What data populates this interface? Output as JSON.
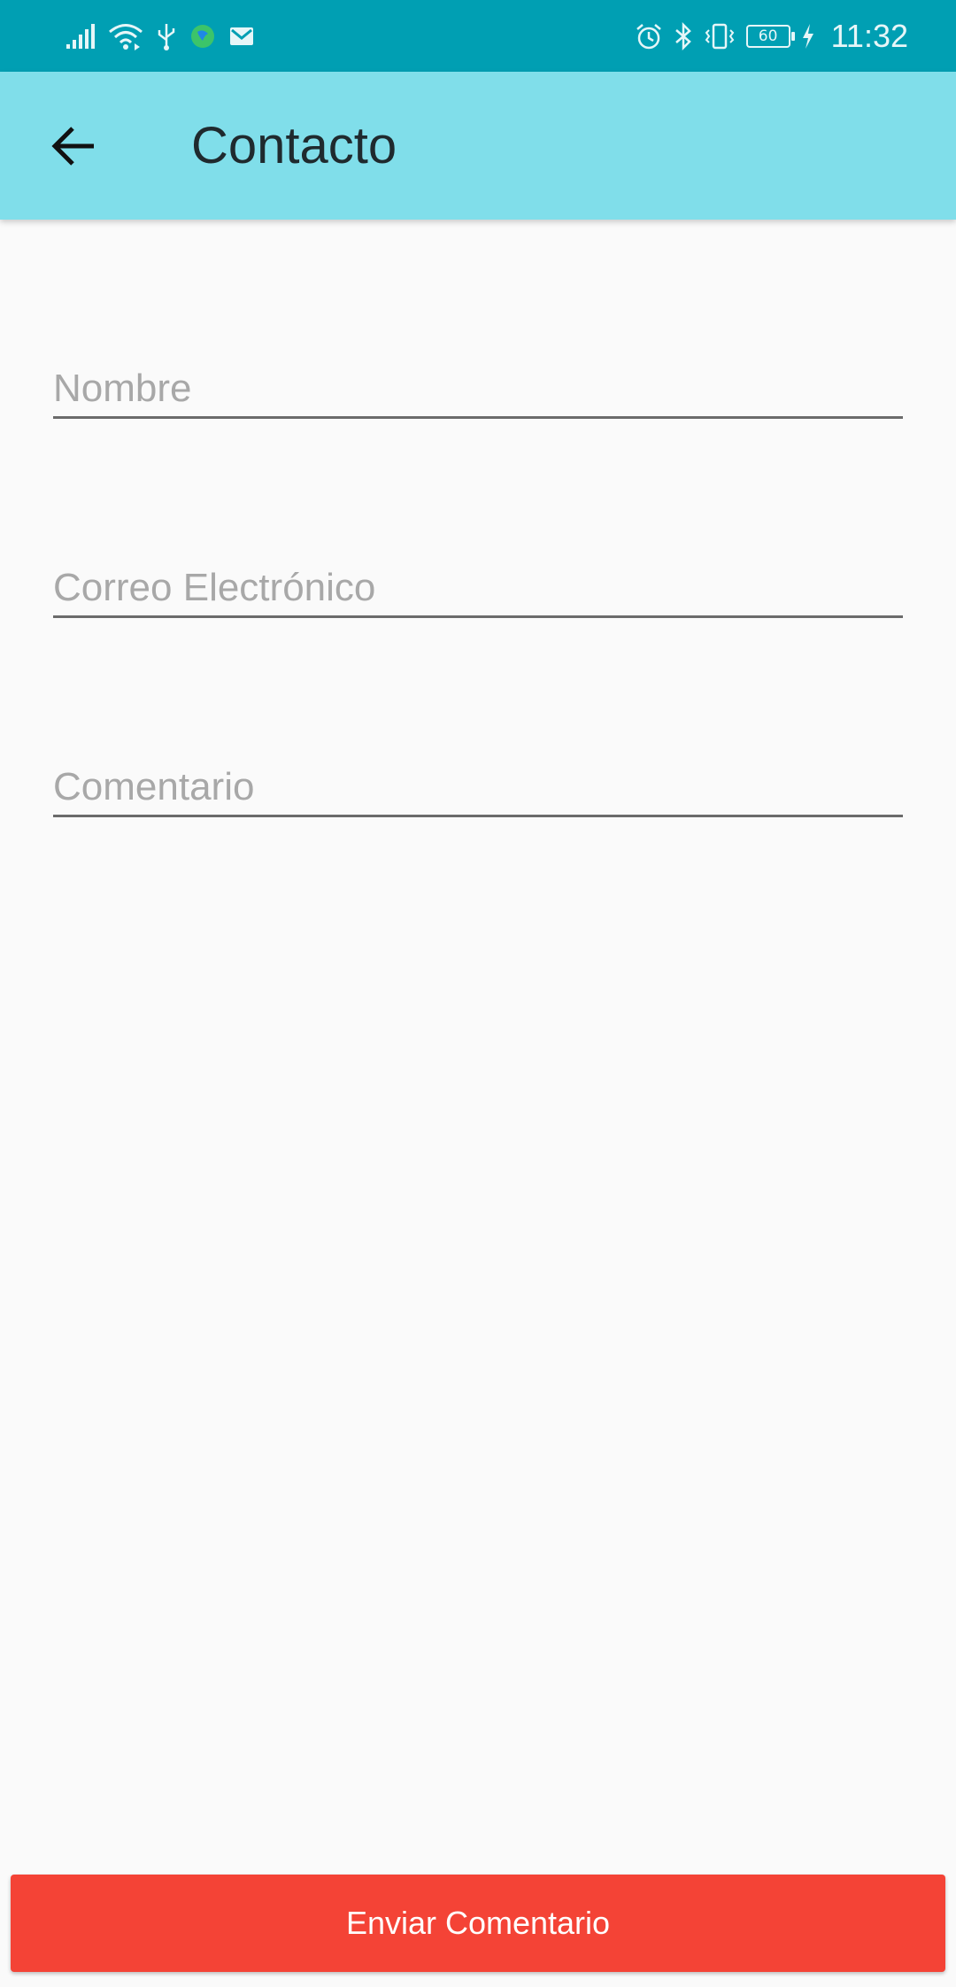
{
  "status_bar": {
    "time": "11:32",
    "battery_level": "60",
    "left_icons": [
      "signal-icon",
      "wifi-icon",
      "usb-icon",
      "app-notification-icon",
      "mail-icon"
    ],
    "right_icons": [
      "alarm-icon",
      "bluetooth-icon",
      "vibrate-icon",
      "battery-icon",
      "charging-icon"
    ],
    "background_color": "#009fb3"
  },
  "app_bar": {
    "title": "Contacto",
    "back_icon": "arrow-left-icon",
    "background_color": "#80deea"
  },
  "form": {
    "nombre": {
      "placeholder": "Nombre",
      "value": ""
    },
    "correo": {
      "placeholder": "Correo Electrónico",
      "value": ""
    },
    "comentario": {
      "placeholder": "Comentario",
      "value": ""
    }
  },
  "submit": {
    "label": "Enviar Comentario",
    "color": "#f44336"
  }
}
